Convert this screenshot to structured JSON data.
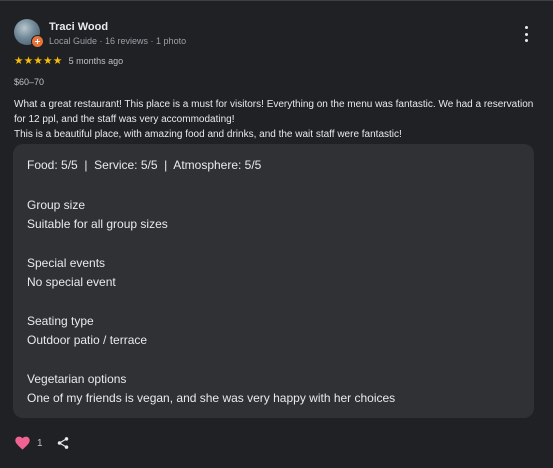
{
  "reviewer": {
    "name": "Traci Wood",
    "meta": "Local Guide · 16 reviews · 1 photo"
  },
  "rating": {
    "stars": "★★★★★",
    "value": 5,
    "max": 5,
    "time": "5 months ago"
  },
  "price": "$60–70",
  "review": {
    "text": "What a great restaurant! This place is a must for visitors! Everything on the menu was fantastic. We had a reservation for 12 ppl, and the staff was very accommodating!\nThis is a beautiful place, with amazing food and drinks, and the wait staff were fantastic!"
  },
  "attributes": {
    "ratings_line": "Food: 5/5  |  Service: 5/5  |  Atmosphere: 5/5",
    "items": [
      {
        "label": "Group size",
        "value": "Suitable for all group sizes"
      },
      {
        "label": "Special events",
        "value": "No special event"
      },
      {
        "label": "Seating type",
        "value": "Outdoor patio / terrace"
      },
      {
        "label": "Vegetarian options",
        "value": "One of my friends is vegan, and she was very happy with her choices"
      }
    ]
  },
  "footer": {
    "like_count": "1",
    "heart_color": "#f06292"
  },
  "icons": {
    "more": "more-vert-icon",
    "like": "heart-icon",
    "share": "share-icon"
  }
}
